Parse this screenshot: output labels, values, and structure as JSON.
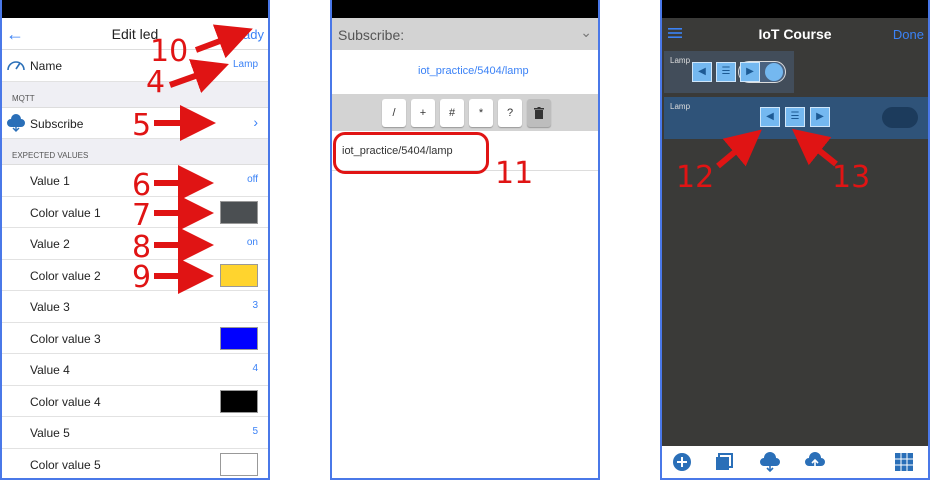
{
  "phone1": {
    "title": "Edit led",
    "back_icon": "back-arrow-icon",
    "ready_label": "Ready",
    "name_label": "Name",
    "name_value": "Lamp",
    "mqtt_section": "MQTT",
    "subscribe_label": "Subscribe",
    "expected_section": "EXPECTED VALUES",
    "rows": [
      {
        "label": "Value 1",
        "value": "off"
      },
      {
        "label": "Color value 1",
        "color": "#4b4f52"
      },
      {
        "label": "Value 2",
        "value": "on"
      },
      {
        "label": "Color value 2",
        "color": "#ffd42e"
      },
      {
        "label": "Value 3",
        "value": "3"
      },
      {
        "label": "Color value 3",
        "color": "#0000ff"
      },
      {
        "label": "Value 4",
        "value": "4"
      },
      {
        "label": "Color value 4",
        "color": "#000000"
      },
      {
        "label": "Value 5",
        "value": "5"
      },
      {
        "label": "Color value 5",
        "color": "#ffffff"
      }
    ]
  },
  "phone2": {
    "header": "Subscribe:",
    "topic_value": "iot_practice/5404/lamp",
    "keys": [
      "/",
      "+",
      "#",
      "*",
      "?"
    ],
    "suggestion": "iot_practice/5404/lamp"
  },
  "phone3": {
    "title": "IoT Course",
    "done_label": "Done",
    "widget1_label": "Lamp",
    "widget2_label": "Lamp"
  },
  "annotations": {
    "n4": "4",
    "n5": "5",
    "n6": "6",
    "n7": "7",
    "n8": "8",
    "n9": "9",
    "n10": "10",
    "n11": "11",
    "n12": "12",
    "n13": "13"
  },
  "colors": {
    "accent": "#3b82f6",
    "annotation": "#e01414",
    "frame": "#4a78e8"
  }
}
